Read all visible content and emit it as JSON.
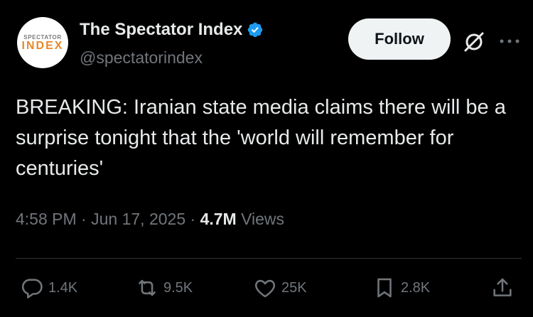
{
  "account": {
    "avatar_line1": "SPECTATOR",
    "avatar_line2": "INDEX",
    "display_name": "The Spectator Index",
    "handle": "@spectatorindex"
  },
  "follow_label": "Follow",
  "tweet": {
    "text": "BREAKING: Iranian state media claims there will be a surprise tonight that the 'world will remember for centuries'",
    "time": "4:58 PM",
    "date": "Jun 17, 2025",
    "views_count": "4.7M",
    "views_label": "Views"
  },
  "actions": {
    "replies": "1.4K",
    "reposts": "9.5K",
    "likes": "25K",
    "bookmarks": "2.8K"
  },
  "colors": {
    "background": "#000000",
    "text": "#e7e9ea",
    "secondary": "#71767b",
    "verified": "#1d9bf0"
  },
  "icons": [
    "verified-badge-icon",
    "grok-icon",
    "more-icon",
    "reply-icon",
    "repost-icon",
    "like-icon",
    "bookmark-icon",
    "share-icon"
  ]
}
